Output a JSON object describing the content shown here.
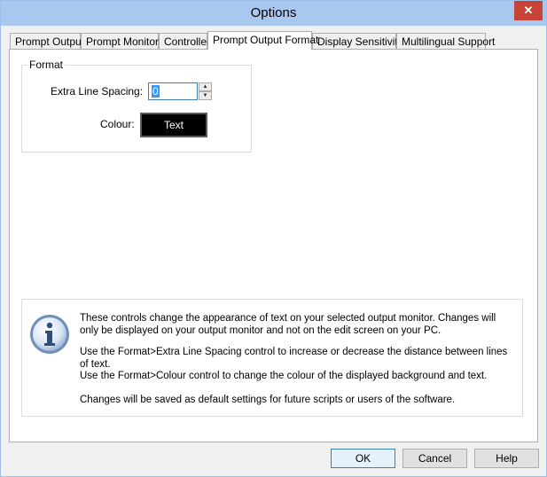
{
  "window": {
    "title": "Options",
    "close_glyph": "✕"
  },
  "tabs": [
    {
      "label": "Prompt Output",
      "active": false
    },
    {
      "label": "Prompt Monitor",
      "active": false
    },
    {
      "label": "Controller",
      "active": false
    },
    {
      "label": "Prompt Output Format",
      "active": true
    },
    {
      "label": "Display Sensitivity",
      "active": false
    },
    {
      "label": "Multilingual Support",
      "active": false
    }
  ],
  "format_group": {
    "legend": "Format",
    "line_spacing_label": "Extra Line Spacing:",
    "line_spacing_value": "0",
    "colour_label": "Colour:",
    "colour_button_text": "Text",
    "colour_button_bg": "#000000",
    "colour_button_fg": "#ffffff"
  },
  "info": {
    "icon": "info-icon",
    "paragraphs": [
      "These controls change the appearance of text on your selected output monitor. Changes will only be displayed on your output monitor and not on the edit screen on your PC.",
      "Use the Format>Extra Line Spacing control to increase or decrease the distance between lines of text.",
      "Use the Format>Colour control to change the colour of the displayed background and text.",
      "Changes will be saved as default settings for future scripts or users of the software."
    ]
  },
  "buttons": {
    "ok": "OK",
    "cancel": "Cancel",
    "help": "Help"
  },
  "colors": {
    "titlebar": "#a8c8f0",
    "close": "#c74335",
    "focus_border": "#3c7fb1",
    "selection": "#3399ff"
  }
}
